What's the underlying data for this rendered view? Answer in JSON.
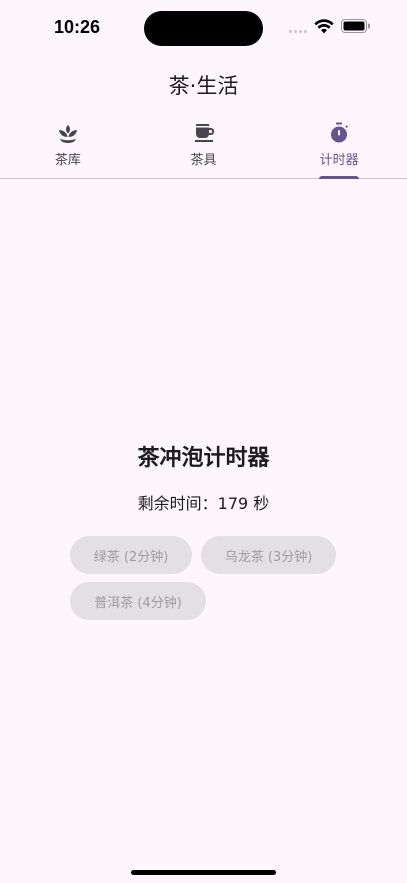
{
  "status_bar": {
    "time": "10:26"
  },
  "app": {
    "title": "茶·生活"
  },
  "tabs": [
    {
      "label": "茶库",
      "icon": "leaf-icon",
      "active": false
    },
    {
      "label": "茶具",
      "icon": "teacup-icon",
      "active": false
    },
    {
      "label": "计时器",
      "icon": "timer-icon",
      "active": true
    }
  ],
  "timer": {
    "title": "茶冲泡计时器",
    "remaining": "剩余时间：179 秒",
    "presets": [
      {
        "label": "绿茶 (2分钟)"
      },
      {
        "label": "乌龙茶 (3分钟)"
      },
      {
        "label": "普洱茶 (4分钟)"
      }
    ]
  },
  "colors": {
    "accent": "#65558f",
    "background": "#fdf7fd",
    "chip_bg": "#e3dfe5",
    "chip_text": "#9e9aa1"
  }
}
